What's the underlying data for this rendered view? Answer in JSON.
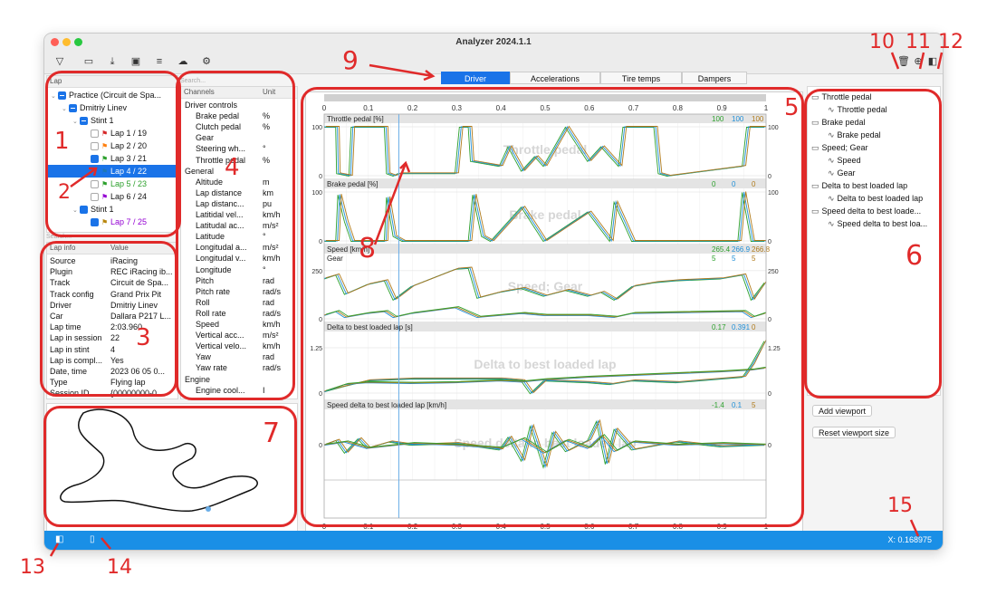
{
  "window": {
    "title": "Analyzer 2024.1.1"
  },
  "toolbar": {
    "icons": [
      "filter-icon",
      "folder-icon",
      "download-icon",
      "terminal-icon",
      "database-icon",
      "cloud-icon",
      "gear-icon"
    ],
    "right_icons": [
      "trash-icon",
      "zoom-icon",
      "sidebar-toggle-icon"
    ]
  },
  "session_tree": {
    "header": "Lap",
    "items": [
      {
        "label": "Practice (Circuit de Spa...",
        "level": 0,
        "check": "part",
        "color": "#111"
      },
      {
        "label": "Dmitriy Linev",
        "level": 1,
        "check": "part",
        "color": "#111"
      },
      {
        "label": "Stint 1",
        "level": 2,
        "check": "part",
        "color": "#111"
      },
      {
        "label": "Lap 1 / 19",
        "level": 3,
        "check": "off",
        "flag": "#d62728",
        "color": "#111"
      },
      {
        "label": "Lap 2 / 20",
        "level": 3,
        "check": "off",
        "flag": "#ff7f0e",
        "color": "#111"
      },
      {
        "label": "Lap 3 / 21",
        "level": 3,
        "check": "on",
        "flag": "#2ca02c",
        "color": "#111"
      },
      {
        "label": "Lap 4 / 22",
        "level": 3,
        "check": "on",
        "flag": "#1f77b4",
        "color": "#fff",
        "selected": true
      },
      {
        "label": "Lap 5 / 23",
        "level": 3,
        "check": "off",
        "flag": "#2ca02c",
        "color": "#2ca02c"
      },
      {
        "label": "Lap 6 / 24",
        "level": 3,
        "check": "off",
        "flag": "#9400d3",
        "color": "#111"
      },
      {
        "label": "Stint 1",
        "level": 2,
        "check": "on",
        "color": "#111"
      },
      {
        "label": "Lap 7 / 25",
        "level": 3,
        "check": "on",
        "flag": "#b8860b",
        "color": "#9400d3"
      }
    ]
  },
  "lap_info": {
    "search_placeholder": "Search...",
    "headers": [
      "Lap info",
      "Value"
    ],
    "rows": [
      [
        "Source",
        "iRacing"
      ],
      [
        "Plugin",
        "REC iRacing ib..."
      ],
      [
        "Track",
        "Circuit de Spa..."
      ],
      [
        "Track config",
        "Grand Prix Pit"
      ],
      [
        "Driver",
        "Dmitriy Linev"
      ],
      [
        "Car",
        "Dallara P217 L..."
      ],
      [
        "Lap time",
        "2:03.960"
      ],
      [
        "Lap in session",
        "22"
      ],
      [
        "Lap in stint",
        "4"
      ],
      [
        "Lap is compl...",
        "Yes"
      ],
      [
        "Date, time",
        "2023 06 05 0..."
      ],
      [
        "Type",
        "Flying lap"
      ],
      [
        "Session ID",
        "{00000000-0..."
      ]
    ]
  },
  "channels": {
    "search_placeholder": "Search...",
    "headers": [
      "Channels",
      "Unit"
    ],
    "rows": [
      {
        "name": "Driver controls",
        "unit": "",
        "group": true
      },
      {
        "name": "Brake pedal",
        "unit": "%"
      },
      {
        "name": "Clutch pedal",
        "unit": "%"
      },
      {
        "name": "Gear",
        "unit": ""
      },
      {
        "name": "Steering wh...",
        "unit": "°"
      },
      {
        "name": "Throttle pedal",
        "unit": "%"
      },
      {
        "name": "General",
        "unit": "",
        "group": true
      },
      {
        "name": "Altitude",
        "unit": "m"
      },
      {
        "name": "Lap distance",
        "unit": "km"
      },
      {
        "name": "Lap distanc...",
        "unit": "pu"
      },
      {
        "name": "Latitidal vel...",
        "unit": "km/h"
      },
      {
        "name": "Latitudal ac...",
        "unit": "m/s²"
      },
      {
        "name": "Latitude",
        "unit": "°"
      },
      {
        "name": "Longitudal a...",
        "unit": "m/s²"
      },
      {
        "name": "Longitudal v...",
        "unit": "km/h"
      },
      {
        "name": "Longitude",
        "unit": "°"
      },
      {
        "name": "Pitch",
        "unit": "rad"
      },
      {
        "name": "Pitch rate",
        "unit": "rad/s"
      },
      {
        "name": "Roll",
        "unit": "rad"
      },
      {
        "name": "Roll rate",
        "unit": "rad/s"
      },
      {
        "name": "Speed",
        "unit": "km/h"
      },
      {
        "name": "Vertical acc...",
        "unit": "m/s²"
      },
      {
        "name": "Vertical velo...",
        "unit": "km/h"
      },
      {
        "name": "Yaw",
        "unit": "rad"
      },
      {
        "name": "Yaw rate",
        "unit": "rad/s"
      },
      {
        "name": "Engine",
        "unit": "",
        "group": true
      },
      {
        "name": "Engine cool...",
        "unit": "I"
      }
    ]
  },
  "tabs": [
    "Driver",
    "Accelerations",
    "Tire temps",
    "Dampers"
  ],
  "viewports": {
    "items": [
      {
        "label": "Throttle pedal",
        "level": 0
      },
      {
        "label": "Throttle pedal",
        "level": 1
      },
      {
        "label": "Brake pedal",
        "level": 0
      },
      {
        "label": "Brake pedal",
        "level": 1
      },
      {
        "label": "Speed; Gear",
        "level": 0
      },
      {
        "label": "Speed",
        "level": 1
      },
      {
        "label": "Gear",
        "level": 1
      },
      {
        "label": "Delta to best loaded lap",
        "level": 0
      },
      {
        "label": "Delta to best loaded lap",
        "level": 1
      },
      {
        "label": "Speed delta to best loade...",
        "level": 0
      },
      {
        "label": "Speed delta to best loa...",
        "level": 1
      }
    ],
    "add_label": "Add viewport",
    "reset_label": "Reset viewport size"
  },
  "status": {
    "x_readout": "X: 0.168975"
  },
  "annotations": [
    "1",
    "2",
    "3",
    "4",
    "5",
    "6",
    "7",
    "8",
    "9",
    "10",
    "11",
    "12",
    "13",
    "14",
    "15"
  ],
  "colors": {
    "accent": "#1a73e8",
    "status": "#1a8fe6",
    "annotation": "#e02a2a",
    "series_green": "#2ca02c",
    "series_blue": "#1f8fd8",
    "series_brown": "#b07a1a"
  },
  "chart_data": {
    "type": "line",
    "x_ticks": [
      "0",
      "0.1",
      "0.2",
      "0.3",
      "0.4",
      "0.5",
      "0.6",
      "0.7",
      "0.8",
      "0.9",
      "1"
    ],
    "xlim": [
      0,
      1
    ],
    "cursor_x": 0.168975,
    "panels": [
      {
        "title": "Throttle pedal [%]",
        "watermark": "Throttle pedal",
        "yticks": [
          "100",
          "0"
        ],
        "ylim": [
          0,
          100
        ],
        "readouts": [
          "100",
          "100",
          "100"
        ],
        "series": [
          {
            "x": [
              0,
              0.03,
              0.032,
              0.06,
              0.065,
              0.14,
              0.145,
              0.16,
              0.17,
              0.3,
              0.31,
              0.33,
              0.335,
              0.4,
              0.42,
              0.45,
              0.48,
              0.5,
              0.55,
              0.6,
              0.63,
              0.67,
              0.68,
              0.75,
              0.76,
              0.78,
              0.95,
              0.96,
              1
            ],
            "y": [
              100,
              100,
              5,
              0,
              100,
              100,
              5,
              0,
              5,
              5,
              100,
              100,
              30,
              20,
              60,
              10,
              40,
              20,
              100,
              30,
              60,
              20,
              100,
              100,
              5,
              0,
              20,
              100,
              100
            ]
          }
        ]
      },
      {
        "title": "Brake pedal [%]",
        "watermark": "Brake pedal",
        "yticks": [
          "100",
          "0"
        ],
        "ylim": [
          0,
          100
        ],
        "readouts": [
          "0",
          "0",
          "0"
        ],
        "series": [
          {
            "x": [
              0,
              0.03,
              0.035,
              0.05,
              0.065,
              0.14,
              0.145,
              0.16,
              0.18,
              0.33,
              0.34,
              0.36,
              0.38,
              0.45,
              0.5,
              0.6,
              0.65,
              0.66,
              0.7,
              0.94,
              0.95,
              0.97,
              1
            ],
            "y": [
              0,
              0,
              95,
              40,
              0,
              0,
              90,
              10,
              0,
              0,
              95,
              10,
              0,
              70,
              0,
              60,
              0,
              80,
              0,
              0,
              100,
              0,
              0
            ]
          }
        ]
      },
      {
        "title": "Speed [km/h]",
        "title2": "Gear",
        "watermark": "Speed; Gear",
        "yticks": [
          "250",
          "0"
        ],
        "ylim": [
          0,
          320
        ],
        "readouts": [
          "265.4",
          "266.9",
          "266.8"
        ],
        "readouts2": [
          "5",
          "5",
          "5"
        ],
        "series": [
          {
            "name": "Speed",
            "x": [
              0,
              0.03,
              0.05,
              0.1,
              0.14,
              0.16,
              0.2,
              0.3,
              0.33,
              0.35,
              0.4,
              0.45,
              0.5,
              0.55,
              0.6,
              0.63,
              0.66,
              0.7,
              0.75,
              0.8,
              0.9,
              0.95,
              0.97,
              1
            ],
            "y": [
              210,
              230,
              130,
              180,
              200,
              100,
              170,
              260,
              265,
              110,
              140,
              160,
              120,
              150,
              120,
              140,
              100,
              170,
              190,
              200,
              210,
              230,
              100,
              190
            ]
          },
          {
            "name": "Gear",
            "x": [
              0,
              0.03,
              0.05,
              0.1,
              0.14,
              0.16,
              0.2,
              0.3,
              0.35,
              0.45,
              0.5,
              0.6,
              0.66,
              0.7,
              0.95,
              0.97,
              1
            ],
            "y": [
              20,
              40,
              10,
              30,
              40,
              10,
              30,
              60,
              10,
              30,
              20,
              20,
              10,
              30,
              40,
              10,
              30
            ]
          }
        ]
      },
      {
        "title": "Delta to best loaded lap [s]",
        "watermark": "Delta to best loaded lap",
        "yticks": [
          "1.25",
          "0"
        ],
        "ylim": [
          -0.1,
          1.6
        ],
        "readouts": [
          "0.17",
          "0.391",
          "0"
        ],
        "series": [
          {
            "x": [
              0,
              0.05,
              0.1,
              0.2,
              0.3,
              0.4,
              0.45,
              0.47,
              0.5,
              0.6,
              0.65,
              0.7,
              0.8,
              0.9,
              0.95,
              0.97,
              1
            ],
            "y": [
              0.05,
              0.2,
              0.35,
              0.4,
              0.4,
              0.4,
              0.35,
              0.0,
              0.35,
              0.3,
              0.25,
              0.35,
              0.3,
              0.4,
              0.45,
              0.8,
              1.45
            ]
          },
          {
            "x": [
              0,
              0.05,
              0.1,
              0.2,
              0.3,
              0.4,
              0.45,
              0.5,
              0.6,
              0.7,
              0.8,
              0.9,
              0.97,
              1
            ],
            "y": [
              0.05,
              0.25,
              0.3,
              0.28,
              0.3,
              0.35,
              0.32,
              0.38,
              0.45,
              0.5,
              0.55,
              0.6,
              0.65,
              0.7
            ]
          }
        ]
      },
      {
        "title": "Speed delta to best loaded lap [km/h]",
        "watermark": "Speed delta to best loaded lap",
        "yticks": [
          "0"
        ],
        "ylim": [
          -20,
          20
        ],
        "readouts": [
          "-1.4",
          "0.1",
          "5"
        ],
        "series": [
          {
            "x": [
              0,
              0.03,
              0.05,
              0.08,
              0.1,
              0.15,
              0.2,
              0.3,
              0.4,
              0.42,
              0.45,
              0.47,
              0.5,
              0.52,
              0.55,
              0.6,
              0.62,
              0.64,
              0.66,
              0.7,
              0.8,
              0.9,
              1
            ],
            "y": [
              0,
              3,
              -5,
              4,
              -2,
              2,
              0,
              1,
              -3,
              5,
              -10,
              12,
              -14,
              8,
              -4,
              3,
              15,
              -12,
              10,
              -3,
              2,
              -1,
              0
            ]
          },
          {
            "x": [
              0,
              0.05,
              0.1,
              0.2,
              0.3,
              0.4,
              0.45,
              0.5,
              0.55,
              0.6,
              0.63,
              0.66,
              0.7,
              0.8,
              0.9,
              1
            ],
            "y": [
              0,
              2,
              -2,
              1,
              0,
              -2,
              4,
              -5,
              3,
              -2,
              6,
              -4,
              2,
              0,
              1,
              0
            ]
          }
        ]
      }
    ]
  }
}
